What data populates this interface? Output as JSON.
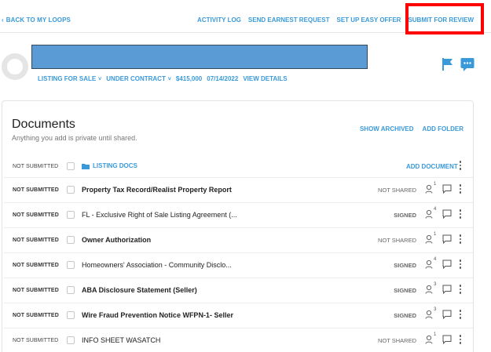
{
  "nav": {
    "back": "BACK TO MY LOOPS",
    "links": [
      "ACTIVITY LOG",
      "SEND EARNEST REQUEST",
      "SET UP EASY OFFER",
      "SUBMIT FOR REVIEW"
    ]
  },
  "header": {
    "listing_type": "LISTING FOR SALE",
    "status": "UNDER CONTRACT",
    "price": "$415,000",
    "date": "07/14/2022",
    "view_details": "VIEW DETAILS"
  },
  "documents": {
    "title": "Documents",
    "subtitle": "Anything you add is private until shared.",
    "show_archived": "SHOW ARCHIVED",
    "add_folder": "ADD FOLDER",
    "folder": {
      "status": "NOT SUBMITTED",
      "name": "LISTING DOCS",
      "add_document": "ADD DOCUMENT"
    },
    "rows": [
      {
        "status": "NOT SUBMITTED",
        "name": "Property Tax Record/Realist Property Report",
        "share": "NOT SHARED",
        "people": "1"
      },
      {
        "status": "NOT SUBMITTED",
        "name": "FL - Exclusive Right of Sale Listing Agreement (...",
        "share": "SIGNED",
        "people": "4"
      },
      {
        "status": "NOT SUBMITTED",
        "name": "Owner Authorization",
        "share": "NOT SHARED",
        "people": "1"
      },
      {
        "status": "NOT SUBMITTED",
        "name": "Homeowners' Association - Community Disclo...",
        "share": "SIGNED",
        "people": "4"
      },
      {
        "status": "NOT SUBMITTED",
        "name": "ABA Disclosure Statement (Seller)",
        "share": "SIGNED",
        "people": "3"
      },
      {
        "status": "NOT SUBMITTED",
        "name": "Wire Fraud Prevention Notice WFPN-1- Seller",
        "share": "SIGNED",
        "people": "3"
      },
      {
        "status": "NOT SUBMITTED",
        "name": "INFO SHEET WASATCH",
        "share": "NOT SHARED",
        "people": "1"
      }
    ]
  },
  "colors": {
    "accent": "#3a9ad9",
    "title_redaction": "#5b9bd5",
    "highlight": "#ff0000"
  },
  "icons": [
    "chevron-left-icon",
    "flag-icon",
    "chat-icon",
    "folder-icon",
    "people-icon",
    "comment-icon",
    "kebab-icon",
    "chevron-down-icon"
  ]
}
